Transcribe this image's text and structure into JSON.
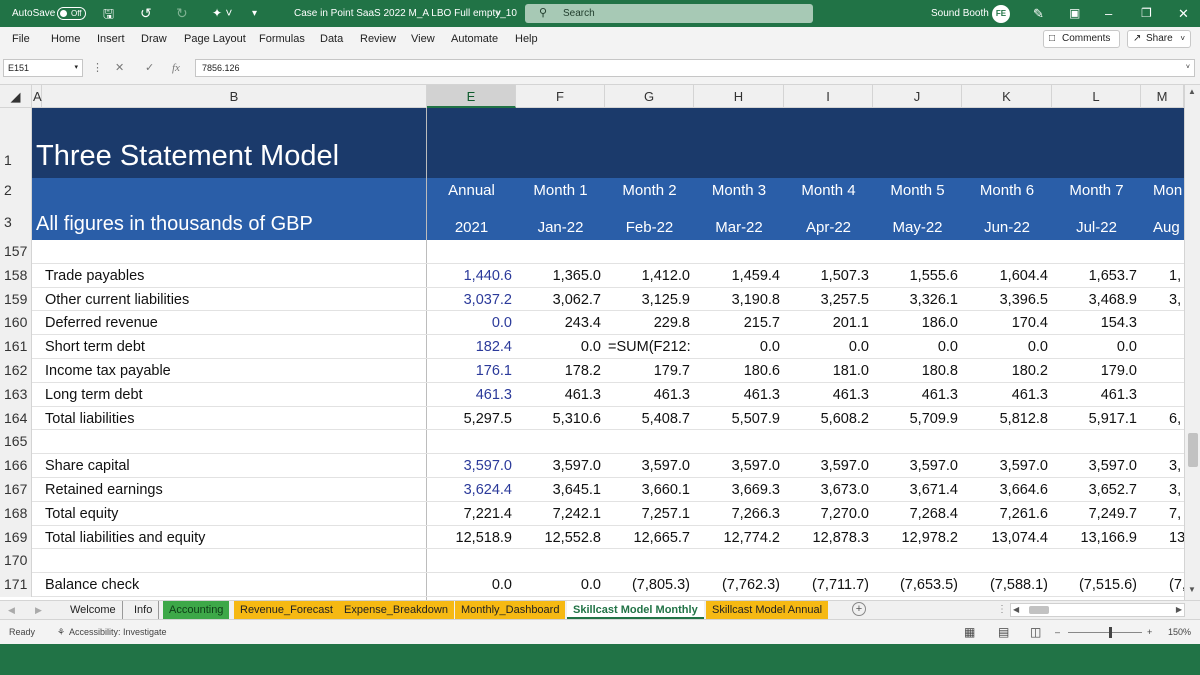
{
  "titlebar": {
    "autosave_label": "AutoSave",
    "autosave_state": "Off",
    "file_title": "Case in Point SaaS 2022 M_A LBO Full empty_10",
    "search_placeholder": "Search",
    "user_name": "Sound Booth",
    "user_initials": "FE"
  },
  "menu": {
    "items": [
      "File",
      "Home",
      "Insert",
      "Draw",
      "Page Layout",
      "Formulas",
      "Data",
      "Review",
      "View",
      "Automate",
      "Help"
    ],
    "comments_label": "Comments",
    "share_label": "Share"
  },
  "formula_bar": {
    "name_box": "E151",
    "fx": "fx",
    "formula": "7856.126"
  },
  "grid": {
    "columns": [
      "A",
      "B",
      "E",
      "F",
      "G",
      "H",
      "I",
      "J",
      "K",
      "L",
      "M"
    ],
    "selected_column": "E",
    "title": "Three Statement Model",
    "subtitle": "All figures in thousands of GBP",
    "header_row_2": [
      "Annual",
      "Month 1",
      "Month 2",
      "Month 3",
      "Month 4",
      "Month 5",
      "Month 6",
      "Month 7",
      "Mon"
    ],
    "header_row_3": [
      "2021",
      "Jan-22",
      "Feb-22",
      "Mar-22",
      "Apr-22",
      "May-22",
      "Jun-22",
      "Jul-22",
      "Aug"
    ],
    "header_row_numbers": [
      "1",
      "2",
      "3"
    ],
    "rows": [
      {
        "num": "157",
        "label": "",
        "values": [
          "",
          "",
          "",
          "",
          "",
          "",
          "",
          "",
          ""
        ]
      },
      {
        "num": "158",
        "label": "Trade payables",
        "values": [
          "1,440.6",
          "1,365.0",
          "1,412.0",
          "1,459.4",
          "1,507.3",
          "1,555.6",
          "1,604.4",
          "1,653.7",
          "1,"
        ]
      },
      {
        "num": "159",
        "label": "Other current liabilities",
        "values": [
          "3,037.2",
          "3,062.7",
          "3,125.9",
          "3,190.8",
          "3,257.5",
          "3,326.1",
          "3,396.5",
          "3,468.9",
          "3,"
        ]
      },
      {
        "num": "160",
        "label": "Deferred revenue",
        "values": [
          "0.0",
          "243.4",
          "229.8",
          "215.7",
          "201.1",
          "186.0",
          "170.4",
          "154.3",
          ""
        ]
      },
      {
        "num": "161",
        "label": "Short term debt",
        "values": [
          "182.4",
          "0.0",
          "=SUM(F212:",
          "0.0",
          "0.0",
          "0.0",
          "0.0",
          "0.0",
          ""
        ]
      },
      {
        "num": "162",
        "label": "Income tax payable",
        "values": [
          "176.1",
          "178.2",
          "179.7",
          "180.6",
          "181.0",
          "180.8",
          "180.2",
          "179.0",
          ""
        ]
      },
      {
        "num": "163",
        "label": "Long term debt",
        "values": [
          "461.3",
          "461.3",
          "461.3",
          "461.3",
          "461.3",
          "461.3",
          "461.3",
          "461.3",
          ""
        ]
      },
      {
        "num": "164",
        "label": "Total liabilities",
        "values": [
          "5,297.5",
          "5,310.6",
          "5,408.7",
          "5,507.9",
          "5,608.2",
          "5,709.9",
          "5,812.8",
          "5,917.1",
          "6,"
        ]
      },
      {
        "num": "165",
        "label": "",
        "values": [
          "",
          "",
          "",
          "",
          "",
          "",
          "",
          "",
          ""
        ]
      },
      {
        "num": "166",
        "label": "Share capital",
        "values": [
          "3,597.0",
          "3,597.0",
          "3,597.0",
          "3,597.0",
          "3,597.0",
          "3,597.0",
          "3,597.0",
          "3,597.0",
          "3,"
        ]
      },
      {
        "num": "167",
        "label": "Retained earnings",
        "values": [
          "3,624.4",
          "3,645.1",
          "3,660.1",
          "3,669.3",
          "3,673.0",
          "3,671.4",
          "3,664.6",
          "3,652.7",
          "3,"
        ]
      },
      {
        "num": "168",
        "label": "Total equity",
        "values": [
          "7,221.4",
          "7,242.1",
          "7,257.1",
          "7,266.3",
          "7,270.0",
          "7,268.4",
          "7,261.6",
          "7,249.7",
          "7,"
        ]
      },
      {
        "num": "169",
        "label": "Total liabilities and equity",
        "values": [
          "12,518.9",
          "12,552.8",
          "12,665.7",
          "12,774.2",
          "12,878.3",
          "12,978.2",
          "13,074.4",
          "13,166.9",
          "13,"
        ]
      },
      {
        "num": "170",
        "label": "",
        "values": [
          "",
          "",
          "",
          "",
          "",
          "",
          "",
          "",
          ""
        ]
      },
      {
        "num": "171",
        "label": "Balance check",
        "values": [
          "0.0",
          "0.0",
          "(7,805.3)",
          "(7,762.3)",
          "(7,711.7)",
          "(7,653.5)",
          "(7,588.1)",
          "(7,515.6)",
          "(7,"
        ]
      }
    ],
    "blue_rows": [
      "158",
      "159",
      "160",
      "161",
      "162",
      "163",
      "166",
      "167"
    ]
  },
  "sheet_tabs": [
    {
      "label": "Welcome",
      "color": ""
    },
    {
      "label": "Info",
      "color": ""
    },
    {
      "label": "Accounting",
      "color": "#3da848"
    },
    {
      "label": "Revenue_Forecast",
      "color": "#f6b913"
    },
    {
      "label": "Expense_Breakdown",
      "color": "#f6b913"
    },
    {
      "label": "Monthly_Dashboard",
      "color": "#f6b913"
    },
    {
      "label": "Skillcast Model Monthly",
      "color": ""
    },
    {
      "label": "Skillcast Model Annual",
      "color": "#f6b913"
    }
  ],
  "active_tab": "Skillcast Model Monthly",
  "statusbar": {
    "ready": "Ready",
    "accessibility": "Accessibility: Investigate",
    "zoom": "150%"
  }
}
